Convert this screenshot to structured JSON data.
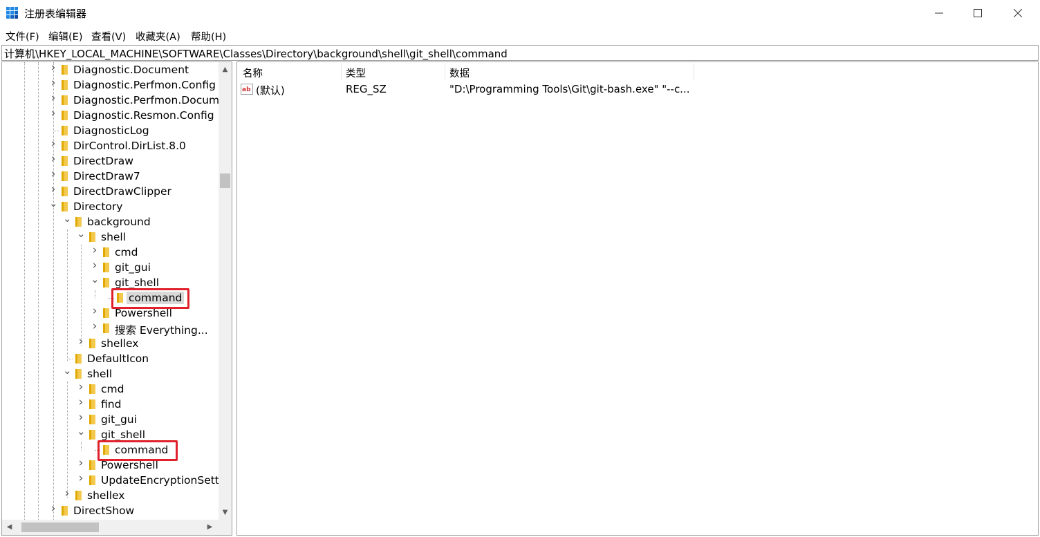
{
  "window": {
    "title": "注册表编辑器",
    "icon": "regedit-icon",
    "controls": {
      "minimize": "minimize-icon",
      "maximize": "maximize-icon",
      "close": "close-icon"
    }
  },
  "menu": [
    {
      "label": "文件(F)"
    },
    {
      "label": "编辑(E)"
    },
    {
      "label": "查看(V)"
    },
    {
      "label": "收藏夹(A)"
    },
    {
      "label": "帮助(H)"
    }
  ],
  "address": "计算机\\HKEY_LOCAL_MACHINE\\SOFTWARE\\Classes\\Directory\\background\\shell\\git_shell\\command",
  "tree": [
    {
      "label": "Diagnostic.Document",
      "depth": 0,
      "state": "collapsed"
    },
    {
      "label": "Diagnostic.Perfmon.Config",
      "depth": 0,
      "state": "collapsed"
    },
    {
      "label": "Diagnostic.Perfmon.Document",
      "depth": 0,
      "state": "collapsed"
    },
    {
      "label": "Diagnostic.Resmon.Config",
      "depth": 0,
      "state": "collapsed"
    },
    {
      "label": "DiagnosticLog",
      "depth": 0,
      "state": "leaf"
    },
    {
      "label": "DirControl.DirList.8.0",
      "depth": 0,
      "state": "collapsed"
    },
    {
      "label": "DirectDraw",
      "depth": 0,
      "state": "collapsed"
    },
    {
      "label": "DirectDraw7",
      "depth": 0,
      "state": "collapsed"
    },
    {
      "label": "DirectDrawClipper",
      "depth": 0,
      "state": "collapsed"
    },
    {
      "label": "Directory",
      "depth": 0,
      "state": "expanded"
    },
    {
      "label": "background",
      "depth": 1,
      "state": "expanded"
    },
    {
      "label": "shell",
      "depth": 2,
      "state": "expanded"
    },
    {
      "label": "cmd",
      "depth": 3,
      "state": "collapsed"
    },
    {
      "label": "git_gui",
      "depth": 3,
      "state": "collapsed"
    },
    {
      "label": "git_shell",
      "depth": 3,
      "state": "expanded"
    },
    {
      "label": "command",
      "depth": 4,
      "state": "leaf",
      "selected": true
    },
    {
      "label": "Powershell",
      "depth": 3,
      "state": "collapsed"
    },
    {
      "label": "搜索 Everything...",
      "depth": 3,
      "state": "collapsed"
    },
    {
      "label": "shellex",
      "depth": 2,
      "state": "collapsed"
    },
    {
      "label": "DefaultIcon",
      "depth": 1,
      "state": "leaf"
    },
    {
      "label": "shell",
      "depth": 1,
      "state": "expanded"
    },
    {
      "label": "cmd",
      "depth": 2,
      "state": "collapsed"
    },
    {
      "label": "find",
      "depth": 2,
      "state": "collapsed"
    },
    {
      "label": "git_gui",
      "depth": 2,
      "state": "collapsed"
    },
    {
      "label": "git_shell",
      "depth": 2,
      "state": "expanded"
    },
    {
      "label": "command",
      "depth": 3,
      "state": "leaf"
    },
    {
      "label": "Powershell",
      "depth": 2,
      "state": "collapsed"
    },
    {
      "label": "UpdateEncryptionSettings",
      "depth": 2,
      "state": "collapsed"
    },
    {
      "label": "shellex",
      "depth": 1,
      "state": "collapsed"
    },
    {
      "label": "DirectShow",
      "depth": 0,
      "state": "collapsed"
    }
  ],
  "list": {
    "columns": [
      "名称",
      "类型",
      "数据"
    ],
    "rows": [
      {
        "name": "(默认)",
        "type": "REG_SZ",
        "data": "\"D:\\Programming Tools\\Git\\git-bash.exe\" \"--c...",
        "icon": "string-value-icon"
      }
    ]
  },
  "colors": {
    "folder": "#f2c94c",
    "highlight": "#e0202a",
    "selection": "#d9d9d9"
  }
}
